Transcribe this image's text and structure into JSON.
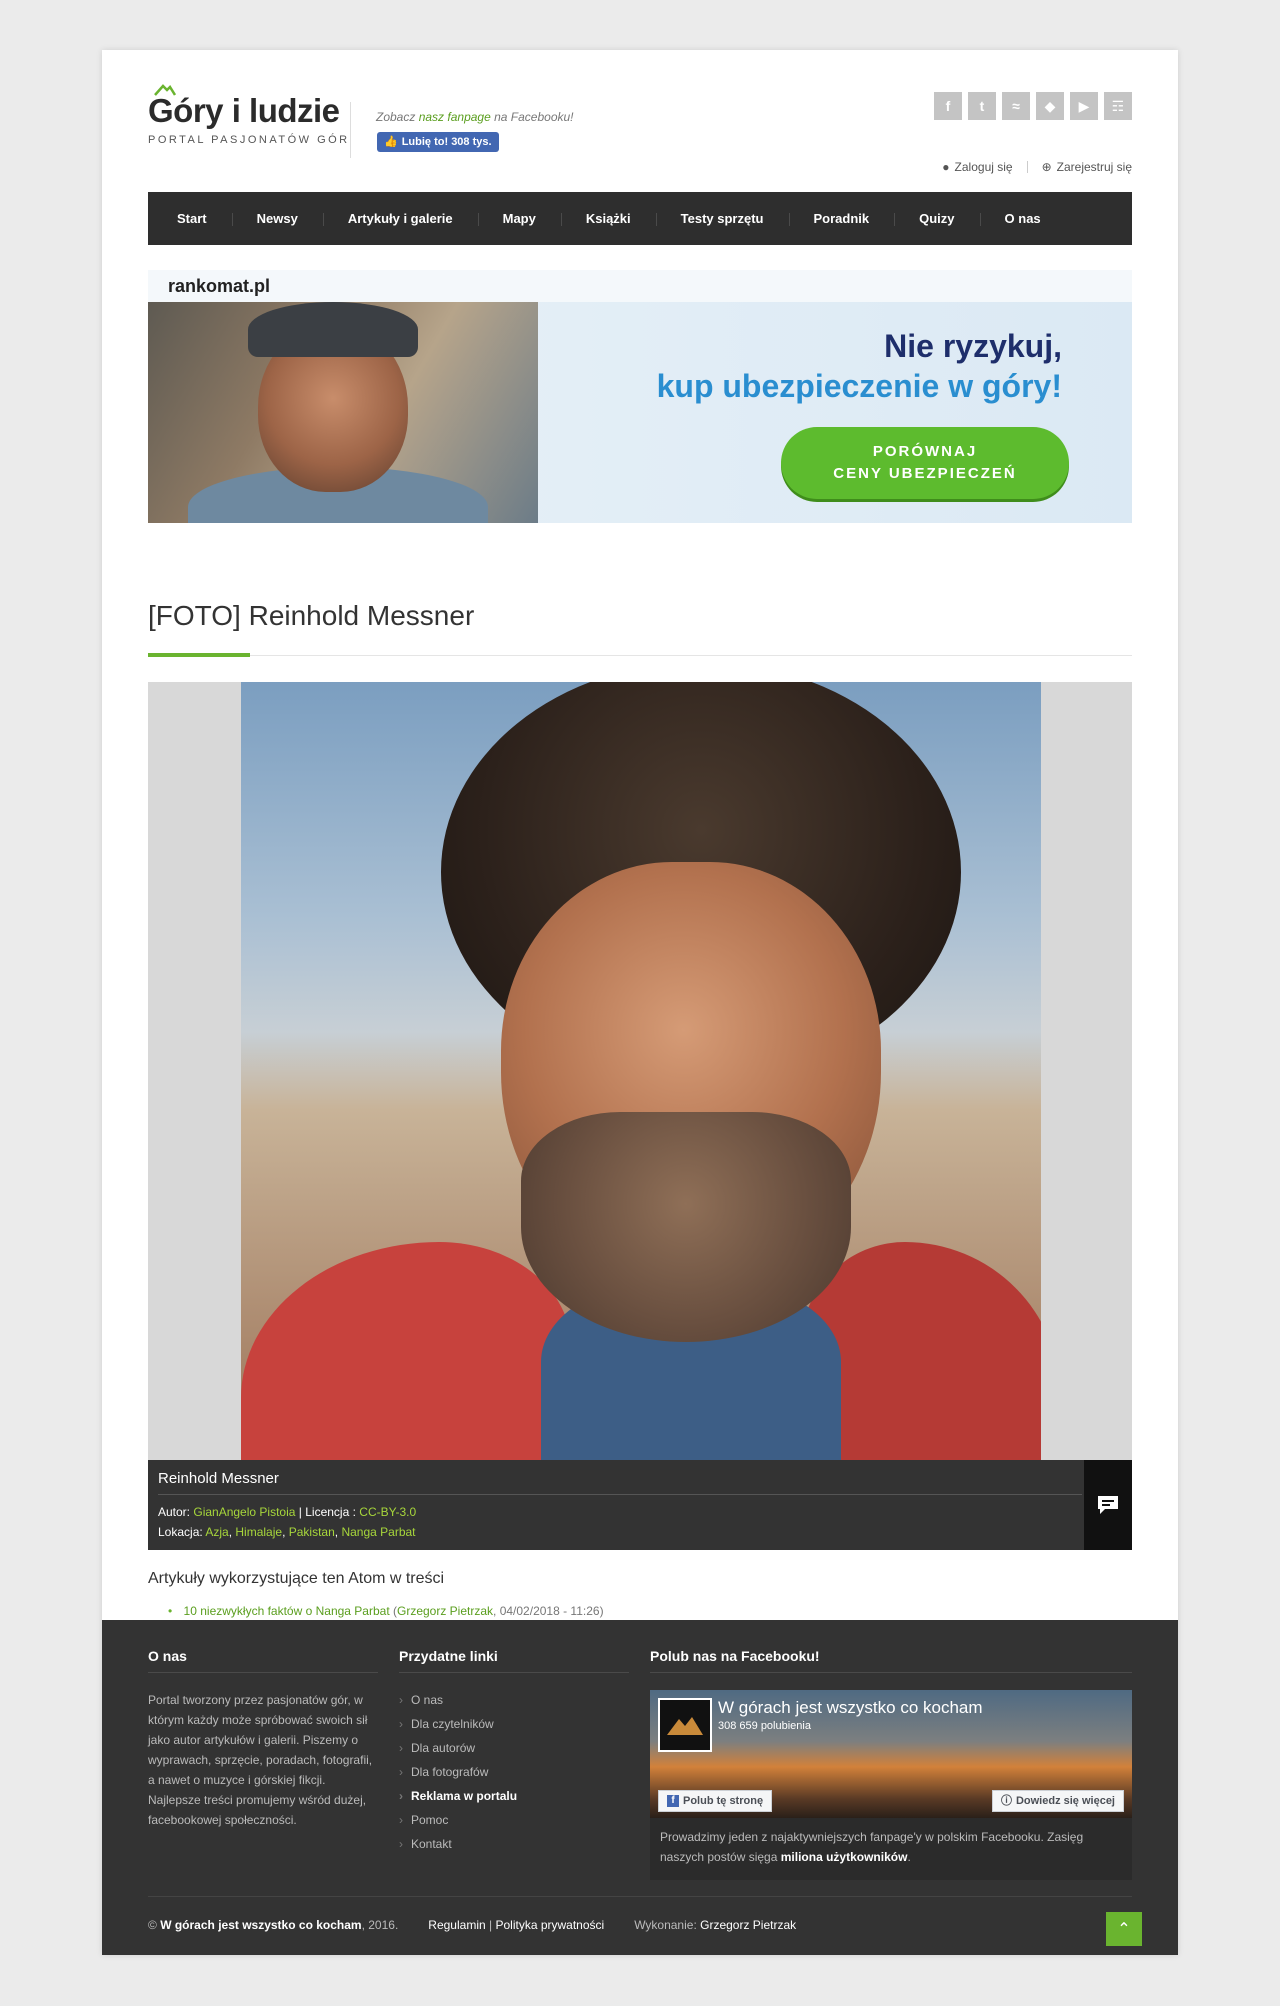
{
  "header": {
    "logo_title": "Góry i ludzie",
    "logo_subtitle": "PORTAL PASJONATÓW GÓR",
    "fb_note_prefix": "Zobacz",
    "fb_note_link": "nasz fanpage",
    "fb_note_suffix": "na Facebooku!",
    "fb_like_label": "Lubię to! 308 tys.",
    "social_icons": [
      "facebook-icon",
      "twitter-icon",
      "rss-icon",
      "tag-icon",
      "youtube-icon",
      "cart-icon"
    ],
    "login_label": "Zaloguj się",
    "register_label": "Zarejestruj się"
  },
  "nav": {
    "items": [
      "Start",
      "Newsy",
      "Artykuły i galerie",
      "Mapy",
      "Książki",
      "Testy sprzętu",
      "Poradnik",
      "Quizy",
      "O nas"
    ]
  },
  "banner": {
    "brand": "rankomat.pl",
    "headline_1": "Nie ryzykuj,",
    "headline_2": "kup ubezpieczenie w góry!",
    "cta_line_1": "PORÓWNAJ",
    "cta_line_2": "CENY UBEZPIECZEŃ"
  },
  "article": {
    "title": "[FOTO] Reinhold Messner"
  },
  "caption": {
    "title": "Reinhold Messner",
    "author_label": "Autor:",
    "author": "GianAngelo Pistoia",
    "license_label": "Licencja :",
    "license": "CC-BY-3.0",
    "location_label": "Lokacja:",
    "locations": [
      "Azja",
      "Himalaje",
      "Pakistan",
      "Nanga Parbat"
    ]
  },
  "related": {
    "heading": "Artykuły wykorzystujące ten Atom w treści",
    "item_title": "10 niezwykłych faktów o Nanga Parbat",
    "item_author": "Grzegorz Pietrzak",
    "item_date": "04/02/2018 - 11:26"
  },
  "footer": {
    "about_heading": "O nas",
    "about_text": "Portal tworzony przez pasjonatów gór, w którym każdy może spróbować swoich sił jako autor artykułów i galerii. Piszemy o wyprawach, sprzęcie, poradach, fotografii, a nawet o muzyce i górskiej fikcji. Najlepsze treści promujemy wśród dużej, facebookowej społeczności.",
    "links_heading": "Przydatne linki",
    "links": [
      "O nas",
      "Dla czytelników",
      "Dla autorów",
      "Dla fotografów",
      "Reklama w portalu",
      "Pomoc",
      "Kontakt"
    ],
    "fb_heading": "Polub nas na Facebooku!",
    "fb_page_name": "W górach jest wszystko co kocham",
    "fb_likes": "308 659 polubienia",
    "fb_like_btn": "Polub tę stronę",
    "fb_more_btn": "Dowiedz się więcej",
    "fb_text_1": "Prowadzimy jeden z najaktywniejszych fanpage'y w polskim Facebooku. Zasięg naszych postów sięga",
    "fb_text_bold": "miliona użytkowników",
    "fb_text_end": ".",
    "copyright_symbol": "©",
    "copyright_name": "W górach jest wszystko co kocham",
    "copyright_year": ", 2016.",
    "regulamin": "Regulamin",
    "privacy": "Polityka prywatności",
    "made_by_label": "Wykonanie:",
    "made_by": "Grzegorz Pietrzak"
  }
}
